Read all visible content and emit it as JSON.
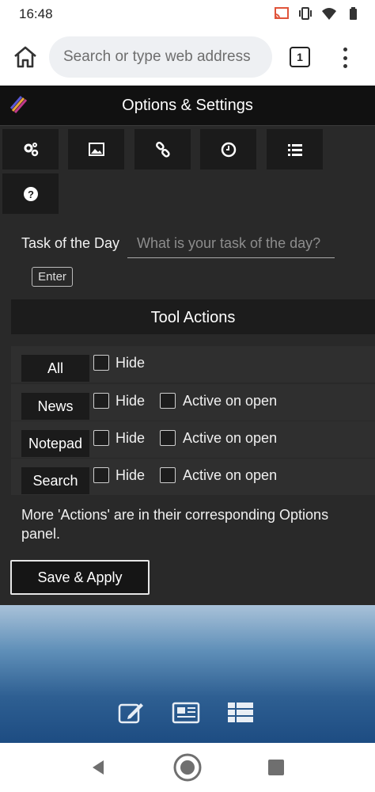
{
  "status_bar": {
    "time": "16:48",
    "icons": [
      "cast-icon",
      "vibrate-icon",
      "wifi-icon",
      "battery-icon"
    ]
  },
  "browser": {
    "url_placeholder": "Search or type web address",
    "tab_count": "1"
  },
  "panel": {
    "title": "Options & Settings",
    "tab_icons": [
      "gears-icon",
      "image-icon",
      "link-icon",
      "clock-icon",
      "list-icon",
      "help-icon"
    ],
    "task": {
      "label": "Task of the Day",
      "placeholder": "What is your task of the day?",
      "enter_label": "Enter"
    },
    "tool_actions": {
      "title": "Tool Actions",
      "rows": [
        {
          "name": "All",
          "hide_label": "Hide",
          "hide_checked": false
        },
        {
          "name": "News",
          "hide_label": "Hide",
          "hide_checked": false,
          "active_label": "Active on open",
          "active_checked": false
        },
        {
          "name": "Notepad",
          "hide_label": "Hide",
          "hide_checked": false,
          "active_label": "Active on open",
          "active_checked": false
        },
        {
          "name": "Search",
          "hide_label": "Hide",
          "hide_checked": false,
          "active_label": "Active on open",
          "active_checked": false
        }
      ]
    },
    "note": "More 'Actions' are in their corresponding Options panel.",
    "save_label": "Save & Apply"
  },
  "bottom_tools": [
    "notepad-icon",
    "news-icon",
    "list-view-icon"
  ],
  "colors": {
    "panel_bg": "#292929",
    "header_bg": "#111111",
    "row_bg": "#2f2f2f"
  }
}
